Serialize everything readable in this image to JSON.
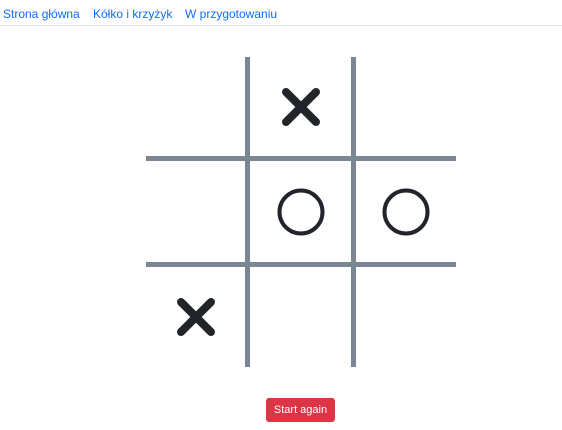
{
  "nav": {
    "items": [
      {
        "label": "Strona główna"
      },
      {
        "label": "Kółko i krzyżyk"
      },
      {
        "label": "W przygotowaniu"
      }
    ]
  },
  "board": {
    "cells": [
      "",
      "X",
      "",
      "",
      "O",
      "O",
      "X",
      "",
      ""
    ],
    "line_color": "#7a8793",
    "mark_color": "#212529"
  },
  "controls": {
    "restart_label": "Start again",
    "restart_color": "#dc3545"
  }
}
